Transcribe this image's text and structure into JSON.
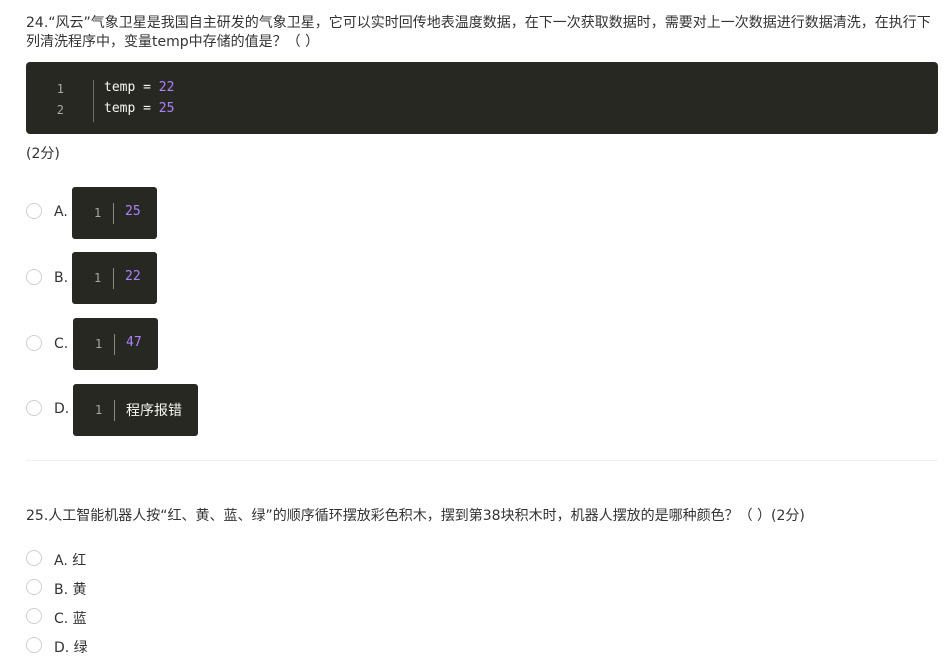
{
  "q24": {
    "text": "24.“风云”气象卫星是我国自主研发的气象卫星，它可以实时回传地表温度数据，在下一次获取数据时，需要对上一次数据进行数据清洗，在执行下列清洗程序中，变量temp中存储的值是？（  ）",
    "code": [
      {
        "line": "1",
        "var": "temp",
        "op": " = ",
        "value": "22"
      },
      {
        "line": "2",
        "var": "temp",
        "op": " = ",
        "value": "25"
      }
    ],
    "score": "(2分)",
    "options": [
      {
        "letter": "A.",
        "line": "1",
        "value": "25"
      },
      {
        "letter": "B.",
        "line": "1",
        "value": "22"
      },
      {
        "letter": "C.",
        "line": "1",
        "value": "47"
      },
      {
        "letter": "D.",
        "line": "1",
        "value": "程序报错"
      }
    ]
  },
  "q25": {
    "text": "25.人工智能机器人按“红、黄、蓝、绿”的顺序循环摆放彩色积木，摆到第38块积木时，机器人摆放的是哪种颜色？（  ）(2分)",
    "options": [
      {
        "label": "A. 红"
      },
      {
        "label": "B. 黄"
      },
      {
        "label": "C. 蓝"
      },
      {
        "label": "D. 绿"
      }
    ]
  },
  "colors": {
    "code_bg": "#272822",
    "number": "#ae81ff",
    "text": "#333333"
  }
}
